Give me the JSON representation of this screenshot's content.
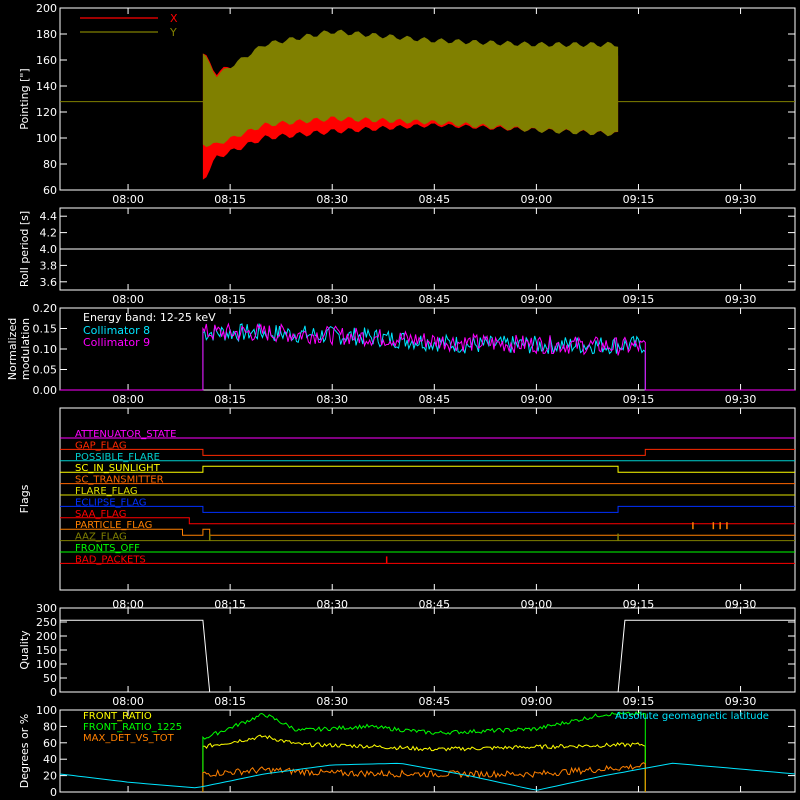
{
  "time_ticks": [
    "08:00",
    "08:15",
    "08:30",
    "08:45",
    "09:00",
    "09:15",
    "09:30"
  ],
  "chart_data": [
    {
      "type": "area",
      "ylabel": "Pointing [\"]",
      "ylim": [
        60,
        200
      ],
      "yticks": [
        "60",
        "80",
        "100",
        "120",
        "140",
        "160",
        "180",
        "200"
      ],
      "legend": [
        {
          "name": "X",
          "color": "#ff0000"
        },
        {
          "name": "Y",
          "color": "#808000"
        }
      ],
      "series": [
        {
          "name": "X",
          "color": "#ff0000",
          "t": [
            "08:11",
            "08:13",
            "08:20",
            "08:30",
            "08:45",
            "09:00",
            "09:12"
          ],
          "upper": [
            165,
            150,
            168,
            175,
            160,
            163,
            165
          ],
          "lower": [
            68,
            85,
            100,
            105,
            110,
            106,
            103
          ]
        },
        {
          "name": "Y",
          "color": "#808000",
          "t": [
            "08:11",
            "08:13",
            "08:20",
            "08:30",
            "08:45",
            "09:00",
            "09:12"
          ],
          "upper": [
            165,
            148,
            172,
            182,
            175,
            172,
            172
          ],
          "lower": [
            95,
            95,
            110,
            115,
            112,
            106,
            103
          ]
        }
      ],
      "reference_line": {
        "y": 128,
        "color": "#808000"
      },
      "segment": [
        "08:11",
        "09:12"
      ]
    },
    {
      "type": "line",
      "ylabel": "Roll period [s]",
      "ylim": [
        3.5,
        4.5
      ],
      "yticks": [
        "3.6",
        "3.8",
        "4.0",
        "4.2",
        "4.4"
      ],
      "series": [
        {
          "color": "#ffffff",
          "t": [
            "07:50",
            "09:38"
          ],
          "values": [
            4.0,
            4.0
          ]
        }
      ]
    },
    {
      "type": "line",
      "ylabel": "Normalized modulation",
      "ylim": [
        0.0,
        0.2
      ],
      "yticks": [
        "0.00",
        "0.05",
        "0.10",
        "0.15",
        "0.20"
      ],
      "annotation": "Energy band: 12-25 keV",
      "legend": [
        {
          "name": "Collimator 8",
          "color": "#00e5ff"
        },
        {
          "name": "Collimator 9",
          "color": "#ff00ff"
        }
      ],
      "series": [
        {
          "name": "Collimator 8",
          "color": "#00e5ff",
          "t": [
            "08:11",
            "08:20",
            "08:35",
            "08:50",
            "09:05",
            "09:16"
          ],
          "values": [
            0.14,
            0.14,
            0.13,
            0.11,
            0.11,
            0.11
          ]
        },
        {
          "name": "Collimator 9",
          "color": "#ff00ff",
          "t": [
            "08:11",
            "08:20",
            "08:35",
            "08:50",
            "09:05",
            "09:16"
          ],
          "values": [
            0.14,
            0.14,
            0.13,
            0.115,
            0.11,
            0.105
          ]
        }
      ],
      "active": [
        "08:11",
        "09:16"
      ]
    },
    {
      "type": "line",
      "ylabel": "Flags",
      "flags": [
        {
          "name": "ATTENUATOR_STATE",
          "color": "#ff00ff",
          "steps": []
        },
        {
          "name": "GAP_FLAG",
          "color": "#ff2a00",
          "steps": [
            [
              "08:11",
              -1
            ],
            [
              "09:16",
              1
            ]
          ]
        },
        {
          "name": "POSSIBLE_FLARE",
          "color": "#00d0d0",
          "steps": []
        },
        {
          "name": "SC_IN_SUNLIGHT",
          "color": "#ffff00",
          "steps": [
            [
              "08:11",
              1
            ],
            [
              "09:12",
              -1
            ]
          ]
        },
        {
          "name": "SC_TRANSMITTER",
          "color": "#ff6600",
          "steps": []
        },
        {
          "name": "FLARE_FLAG",
          "color": "#e0e000",
          "steps": []
        },
        {
          "name": "ECLIPSE_FLAG",
          "color": "#0030ff",
          "steps": [
            [
              "08:11",
              -1
            ],
            [
              "09:12",
              1
            ]
          ]
        },
        {
          "name": "SAA_FLAG",
          "color": "#ff0000",
          "steps": [
            [
              "08:09",
              -1
            ]
          ]
        },
        {
          "name": "PARTICLE_FLAG",
          "color": "#ff8000",
          "steps": [
            [
              "08:08",
              -1
            ],
            [
              "08:11",
              1
            ],
            [
              "08:12",
              -1
            ],
            [
              "09:16",
              -1
            ]
          ],
          "spikes": [
            "09:23",
            "09:26",
            "09:27",
            "09:28"
          ]
        },
        {
          "name": "AAZ_FLAG",
          "color": "#808000",
          "spikes": [
            "08:12",
            "09:12"
          ]
        },
        {
          "name": "FRONTS_OFF",
          "color": "#00ff00",
          "steps": []
        },
        {
          "name": "BAD_PACKETS",
          "color": "#ff0000",
          "spikes": [
            "08:38"
          ]
        }
      ]
    },
    {
      "type": "line",
      "ylabel": "Quality",
      "ylim": [
        0,
        300
      ],
      "yticks": [
        "0",
        "50",
        "100",
        "150",
        "200",
        "250",
        "300"
      ],
      "series": [
        {
          "color": "#ffffff",
          "t": [
            "07:50",
            "08:11",
            "08:12",
            "09:12",
            "09:13",
            "09:38"
          ],
          "values": [
            256,
            256,
            0,
            0,
            256,
            256
          ]
        }
      ]
    },
    {
      "type": "line",
      "ylabel": "Degrees or %",
      "ylim": [
        0,
        100
      ],
      "yticks": [
        "0",
        "20",
        "40",
        "60",
        "80",
        "100"
      ],
      "legend": [
        {
          "name": "FRONT_RATIO",
          "color": "#ffff00"
        },
        {
          "name": "FRONT_RATIO_1225",
          "color": "#00ff00"
        },
        {
          "name": "MAX_DET_VS_TOT",
          "color": "#ff8000"
        },
        {
          "name": "Absolute geomagnetic latitude",
          "color": "#00e5ff"
        }
      ],
      "series": [
        {
          "name": "FRONT_RATIO",
          "color": "#ffff00",
          "t": [
            "08:11",
            "08:20",
            "08:25",
            "08:35",
            "08:45",
            "09:00",
            "09:10",
            "09:16"
          ],
          "values": [
            55,
            68,
            58,
            56,
            52,
            55,
            57,
            58
          ]
        },
        {
          "name": "FRONT_RATIO_1225",
          "color": "#00ff00",
          "t": [
            "08:11",
            "08:20",
            "08:25",
            "08:35",
            "08:45",
            "09:00",
            "09:10",
            "09:16"
          ],
          "values": [
            65,
            95,
            75,
            80,
            72,
            77,
            95,
            95
          ]
        },
        {
          "name": "MAX_DET_VS_TOT",
          "color": "#ff8000",
          "t": [
            "08:11",
            "08:20",
            "08:30",
            "08:45",
            "09:00",
            "09:16"
          ],
          "values": [
            22,
            27,
            23,
            22,
            22,
            32
          ]
        },
        {
          "name": "Absolute geomagnetic latitude",
          "color": "#00e5ff",
          "t": [
            "07:50",
            "08:00",
            "08:10",
            "08:20",
            "08:30",
            "08:40",
            "08:50",
            "09:00",
            "09:10",
            "09:20",
            "09:30",
            "09:38"
          ],
          "values": [
            22,
            12,
            5,
            22,
            33,
            35,
            20,
            2,
            20,
            35,
            28,
            22
          ]
        }
      ]
    }
  ]
}
